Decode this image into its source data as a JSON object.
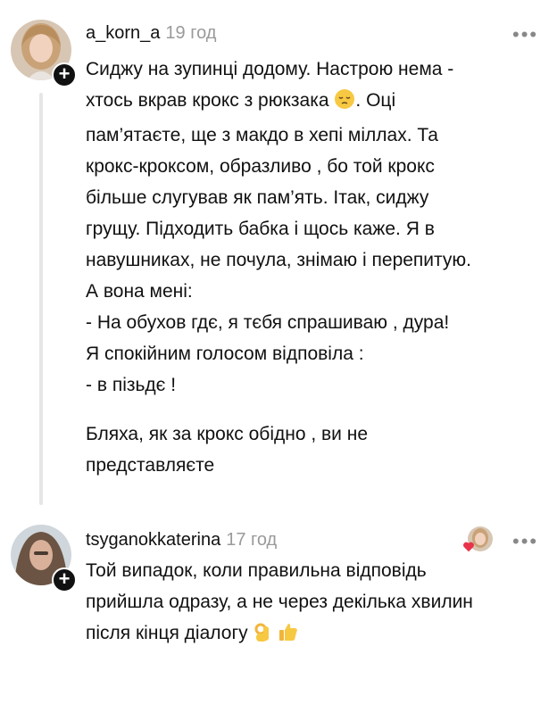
{
  "comments": [
    {
      "username": "a_korn_a",
      "time": "19 год",
      "more_icon": "more-dots-icon",
      "lines": [
        "Сиджу на зупинці додому. Настрою нема -",
        "хтось вкрав крокс з рюкзака",
        ". Оці",
        "пам’ятаєте, ще з макдо в хепі міллах. Та",
        "крокс-кроксом, образливо ,  бо той крокс",
        "більше слугував як пам’ять. Ітак, сиджу",
        "грущу. Підходить бабка і щось каже. Я в",
        "навушниках, не почула, знімаю і перепитую.",
        "А вона мені:",
        "- На обухов гдє, я тєбя спрашиваю , дура!",
        "Я спокійним голосом відповіла :",
        "- в пізьдє !",
        "Бляха, як за крокс обідно , ви не",
        "представляєте"
      ],
      "emoji": "pensive-face-emoji"
    },
    {
      "username": "tsyganokkaterina",
      "time": "17 год",
      "more_icon": "more-dots-icon",
      "lines": [
        "Той випадок, коли правильна відповідь",
        "прийшла одразу, а не через декілька хвилин",
        "після кінця діалогу"
      ],
      "emojis": [
        "ok-hand-emoji",
        "thumbs-up-emoji"
      ],
      "liked_by_author": true
    }
  ],
  "colors": {
    "text": "#111111",
    "timestamp": "#9a9a9a",
    "thread_line": "#e6e6e6",
    "heart": "#e8334a"
  }
}
